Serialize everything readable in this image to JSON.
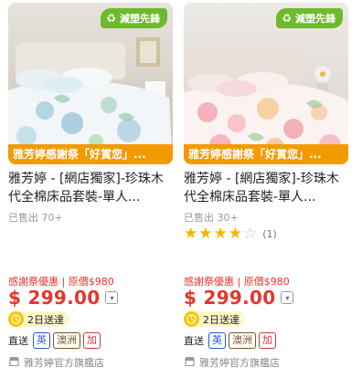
{
  "products": [
    {
      "eco_badge": "減塑先鋒",
      "eco_icon": "recycle-icon",
      "promo_banner": "雅芳婷感謝祭「好賞您」...",
      "title": "雅芳婷 - [網店獨家]-珍珠木代全棉床品套裝-單人...",
      "sold": "已售出 70+",
      "rating": null,
      "original_price": "感謝祭優惠 | 原價$980",
      "price": "$ 299.00",
      "delivery": "2日送達",
      "ship_label": "直送",
      "ship_tags": [
        "英",
        "澳洲",
        "加"
      ],
      "store": "雅芳婷官方旗艦店"
    },
    {
      "eco_badge": "減塑先鋒",
      "eco_icon": "recycle-icon",
      "promo_banner": "雅芳婷感謝祭「好賞您」...",
      "title": "雅芳婷 - [網店獨家]-珍珠木代全棉床品套裝-單人...",
      "sold": "已售出 30+",
      "rating": {
        "stars": 4,
        "max": 5,
        "count": "(1)"
      },
      "original_price": "感謝祭優惠 | 原價$980",
      "price": "$ 299.00",
      "delivery": "2日送達",
      "ship_label": "直送",
      "ship_tags": [
        "英",
        "澳洲",
        "加"
      ],
      "store": "雅芳婷官方旗艦店"
    }
  ],
  "colors": {
    "eco_green": "#6fb92c",
    "promo_orange": "#f39a00",
    "price_red": "#e5352d",
    "star_yellow": "#f2b600",
    "delivery_bg": "#fdf7c9",
    "tag_uk": "#2a55c9",
    "tag_au": "#7d5428",
    "tag_ca": "#d23a3a"
  }
}
